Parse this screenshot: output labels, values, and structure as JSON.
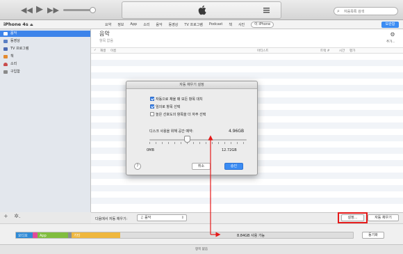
{
  "toolbar": {
    "search_placeholder": "자음목록 검색"
  },
  "navbar": {
    "device_name": "iPhone 4s",
    "tabs": [
      "요약",
      "정보",
      "App",
      "소리",
      "음악",
      "동영상",
      "TV 프로그램",
      "Podcast",
      "책",
      "사진",
      "이 iPhone"
    ],
    "apply_label": "보관함"
  },
  "sidebar": {
    "items": [
      {
        "label": "음악",
        "icon": "music-icon",
        "color": "#ff6f6f",
        "selected": true
      },
      {
        "label": "동영상",
        "icon": "film-icon",
        "color": "#5a7fc4"
      },
      {
        "label": "TV 프로그램",
        "icon": "tv-icon",
        "color": "#4d6bb3"
      },
      {
        "label": "책",
        "icon": "book-icon",
        "color": "#e48a2f"
      },
      {
        "label": "소리",
        "icon": "bell-icon",
        "color": "#c94d4d"
      },
      {
        "label": "구입함",
        "icon": "purchase-icon",
        "color": "#8a8a8a"
      }
    ],
    "add_label": "+",
    "gear_label": "✲."
  },
  "main": {
    "heading": "음악",
    "subheading": "항목 없음",
    "options_label": "추가...",
    "columns": [
      "재생",
      "이름",
      "아티스트",
      "트랙 #",
      "시간",
      "평가"
    ]
  },
  "bottombar": {
    "autofill_label": "다음에서 자동 채우기:",
    "autofill_source": "음악",
    "settings_label": "설정...",
    "autofill_button": "자동 채우기"
  },
  "capacity": {
    "segments": [
      {
        "label": "오디오",
        "color": "#2f8ad6"
      },
      {
        "label": "",
        "color": "#e04a9a"
      },
      {
        "label": "App",
        "color": "#80bd3e"
      },
      {
        "label": "",
        "color": "#8b8f8f"
      },
      {
        "label": "기타",
        "color": "#efb73e"
      }
    ],
    "free_label": "8.84GB 사용 가능",
    "sync_label": "동기화"
  },
  "status": {
    "text": "항목 없음"
  },
  "dialog": {
    "title": "자동 채우기 설정",
    "options": [
      {
        "label": "자동으로 채울 때 모든 항목 대치",
        "checked": true
      },
      {
        "label": "임의로 항목 선택",
        "checked": true
      },
      {
        "label": "높은 선호도의 항목을 더 자주 선택",
        "checked": false
      }
    ],
    "disk_label": "디스크 사용을 위해 공간 예약:",
    "disk_value": "4.96GB",
    "slider_min": "0MB",
    "slider_max": "12.72GB",
    "slider_fraction": 0.39,
    "help_label": "?",
    "cancel_label": "취소",
    "ok_label": "승인"
  },
  "annotation": {
    "color": "#e51a1a"
  }
}
